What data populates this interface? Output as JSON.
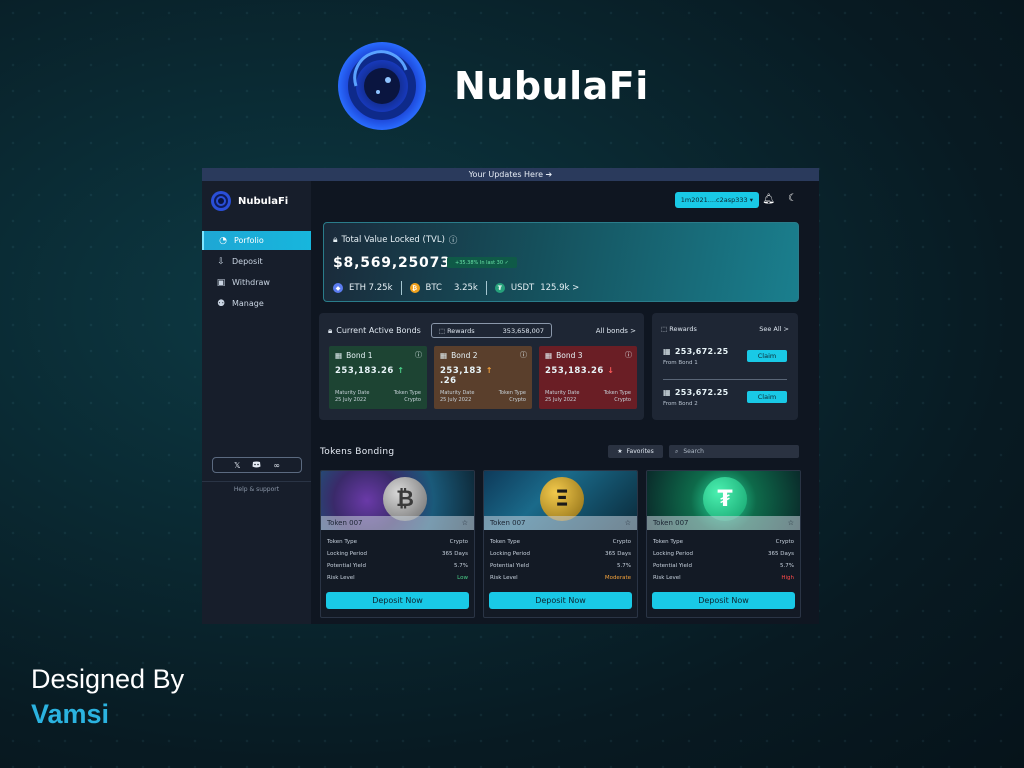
{
  "brand": {
    "name": "NubulaFi"
  },
  "app": {
    "banner": "Your Updates Here ➔",
    "sidebar": {
      "logo": "NubulaFi",
      "items": [
        {
          "label": "Porfolio",
          "icon": "clock-icon",
          "active": true
        },
        {
          "label": "Deposit",
          "icon": "deposit-icon",
          "active": false
        },
        {
          "label": "Withdraw",
          "icon": "wallet-icon",
          "active": false
        },
        {
          "label": "Manage",
          "icon": "users-icon",
          "active": false
        }
      ],
      "social": [
        "𝕏",
        "discord",
        "meta"
      ],
      "help": "Help & support"
    },
    "header": {
      "wallet": "1m2021....c2asp333 ▾"
    },
    "tvl": {
      "title": "Total Value Locked (TVL)",
      "value": "$8,569,25073",
      "change": "+35.38% In last 30 ✓",
      "eth": "ETH 7.25k",
      "btc": "BTC",
      "btc_value": "3.25k",
      "usdt": "USDT",
      "usdt_value": "125.9k >"
    },
    "bonds": {
      "title": "Current Active Bonds",
      "rewards_label": "Rewards",
      "rewards_value": "353,658,007",
      "all_bonds": "All bonds >",
      "items": [
        {
          "name": "Bond 1",
          "value": "253,183.26",
          "maturity_label": "Maturity Date",
          "maturity": "25 July 2022",
          "type_label": "Token Type",
          "type": "Crypto",
          "trend": "↑"
        },
        {
          "name": "Bond 2",
          "value": "253,183",
          "value2": ".26",
          "maturity_label": "Maturity Date",
          "maturity": "25 July 2022",
          "type_label": "Token Type",
          "type": "Crypto",
          "trend": "↑"
        },
        {
          "name": "Bond 3",
          "value": "253,183.26",
          "maturity_label": "Maturity Date",
          "maturity": "25 July 2022",
          "type_label": "Token Type",
          "type": "Crypto",
          "trend": "↓"
        }
      ]
    },
    "rewards": {
      "title": "Rewards",
      "see_all": "See All >",
      "items": [
        {
          "amount": "253,672.25",
          "from": "From Bond 1",
          "button": "Claim"
        },
        {
          "amount": "253,672.25",
          "from": "From Bond 2",
          "button": "Claim"
        }
      ]
    },
    "tokens": {
      "title": "Tokens Bonding",
      "favorites": "Favorites",
      "search_placeholder": "Search",
      "cards": [
        {
          "name": "Token 007",
          "coin": "₿",
          "type": "Crypto",
          "locking": "365 Days",
          "yield": "5.7%",
          "risk": "Low",
          "button": "Deposit Now"
        },
        {
          "name": "Token 007",
          "coin": "Ξ",
          "type": "Crypto",
          "locking": "365 Days",
          "yield": "5.7%",
          "risk": "Moderate",
          "button": "Deposit Now"
        },
        {
          "name": "Token 007",
          "coin": "₮",
          "type": "Crypto",
          "locking": "365 Days",
          "yield": "5.7%",
          "risk": "High",
          "button": "Deposit Now"
        }
      ],
      "row_labels": {
        "type": "Token Type",
        "locking": "Locking Period",
        "yield": "Potential Yield",
        "risk": "Risk Level"
      }
    }
  },
  "credits": {
    "line1": "Designed By",
    "line2": "Vamsi"
  },
  "colors": {
    "accent": "#19c9e6",
    "bond1": "#1d4433",
    "bond2": "#5a3f2c",
    "bond3": "#6a1e25"
  }
}
